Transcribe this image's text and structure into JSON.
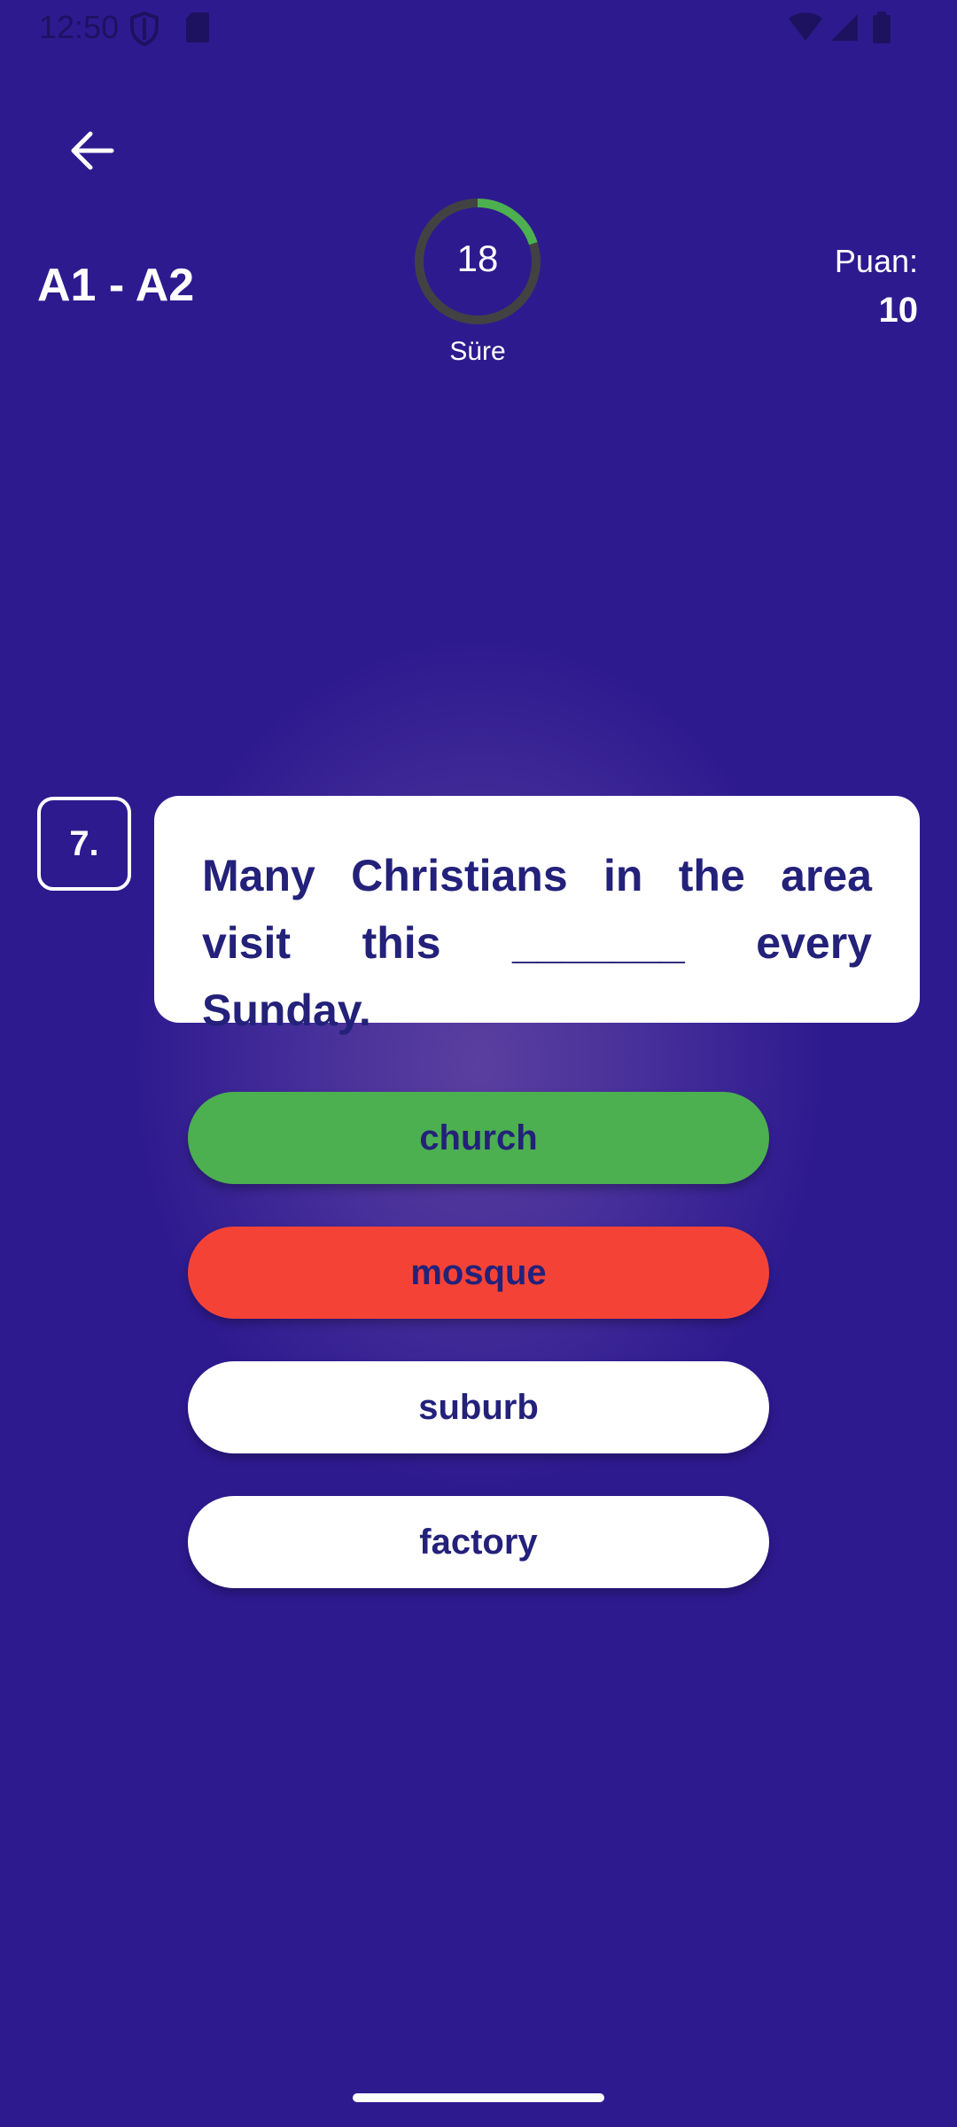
{
  "status_bar": {
    "time": "12:50",
    "icons_left": [
      "shield-icon",
      "sd-card-icon"
    ],
    "icons_right": [
      "wifi-icon",
      "signal-icon",
      "battery-icon"
    ]
  },
  "header": {
    "back_icon": "arrow-left-icon",
    "level_title": "A1 - A2",
    "timer_value": "18",
    "timer_label": "Süre",
    "timer_remaining_fraction": 0.2,
    "score_label": "Puan:",
    "score_value": "10"
  },
  "question": {
    "number": "7.",
    "text": "Many Christians in the area visit this _______ every Sunday."
  },
  "options": [
    {
      "label": "church",
      "state": "correct"
    },
    {
      "label": "mosque",
      "state": "wrong"
    },
    {
      "label": "suburb",
      "state": "default"
    },
    {
      "label": "factory",
      "state": "default"
    }
  ],
  "colors": {
    "background": "#2e1a8f",
    "correct": "#4caf50",
    "wrong": "#f44336",
    "text_dark": "#23217a",
    "timer_progress": "#4caf50",
    "timer_track": "#424242"
  }
}
